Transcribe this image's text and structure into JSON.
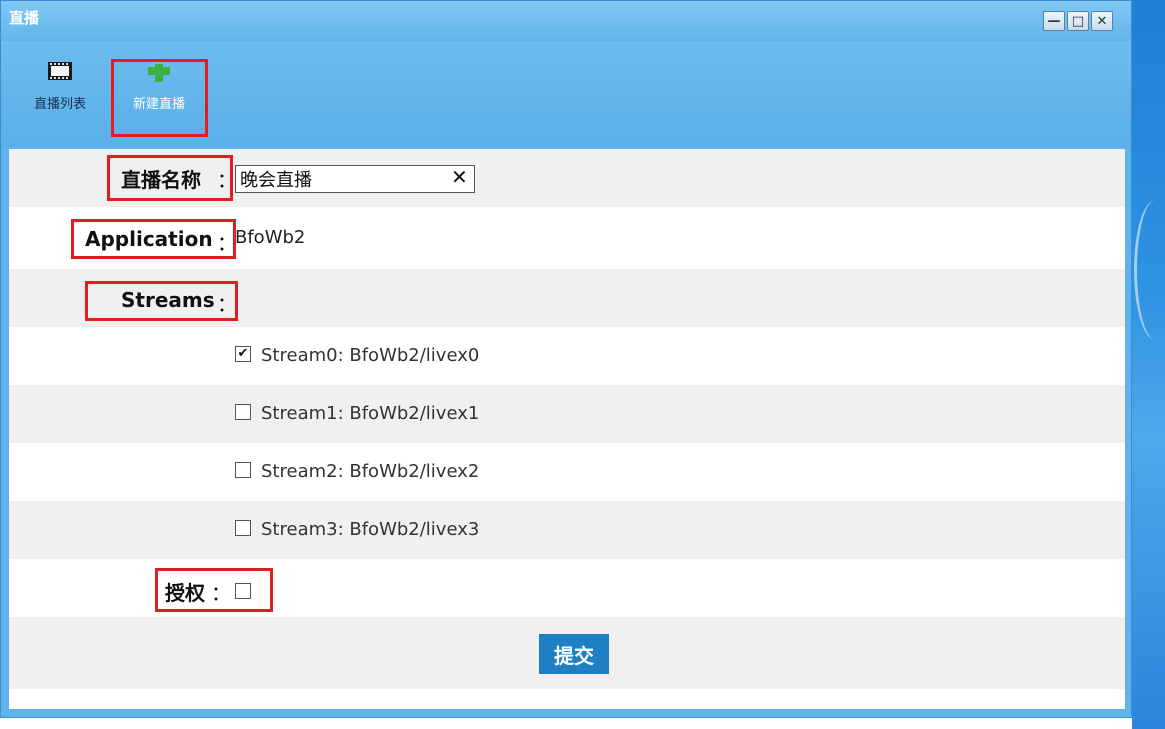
{
  "window": {
    "title": "直播"
  },
  "window_controls": {
    "minimize": "—",
    "maximize": "□",
    "close": "✕"
  },
  "toolbar": {
    "items": [
      {
        "label": "直播列表",
        "icon": "film-icon"
      },
      {
        "label": "新建直播",
        "icon": "plus-icon"
      }
    ]
  },
  "form": {
    "name": {
      "label": "直播名称",
      "colon": "：",
      "value": "晚会直播",
      "clear": "✕"
    },
    "application": {
      "label": "Application",
      "colon": "：",
      "value": "BfoWb2"
    },
    "streams": {
      "label": "Streams",
      "colon": "：",
      "items": [
        {
          "label": "Stream0:  BfoWb2/livex0",
          "checked": true,
          "mark": "✔"
        },
        {
          "label": "Stream1:  BfoWb2/livex1",
          "checked": false,
          "mark": ""
        },
        {
          "label": "Stream2:  BfoWb2/livex2",
          "checked": false,
          "mark": ""
        },
        {
          "label": "Stream3:  BfoWb2/livex3",
          "checked": false,
          "mark": ""
        }
      ]
    },
    "auth": {
      "label": "授权",
      "colon": "：",
      "checked": false
    },
    "submit_label": "提交"
  },
  "colors": {
    "titlebar": "#62b5ec",
    "highlight_box": "#e02020",
    "submit": "#1f7fc4"
  }
}
